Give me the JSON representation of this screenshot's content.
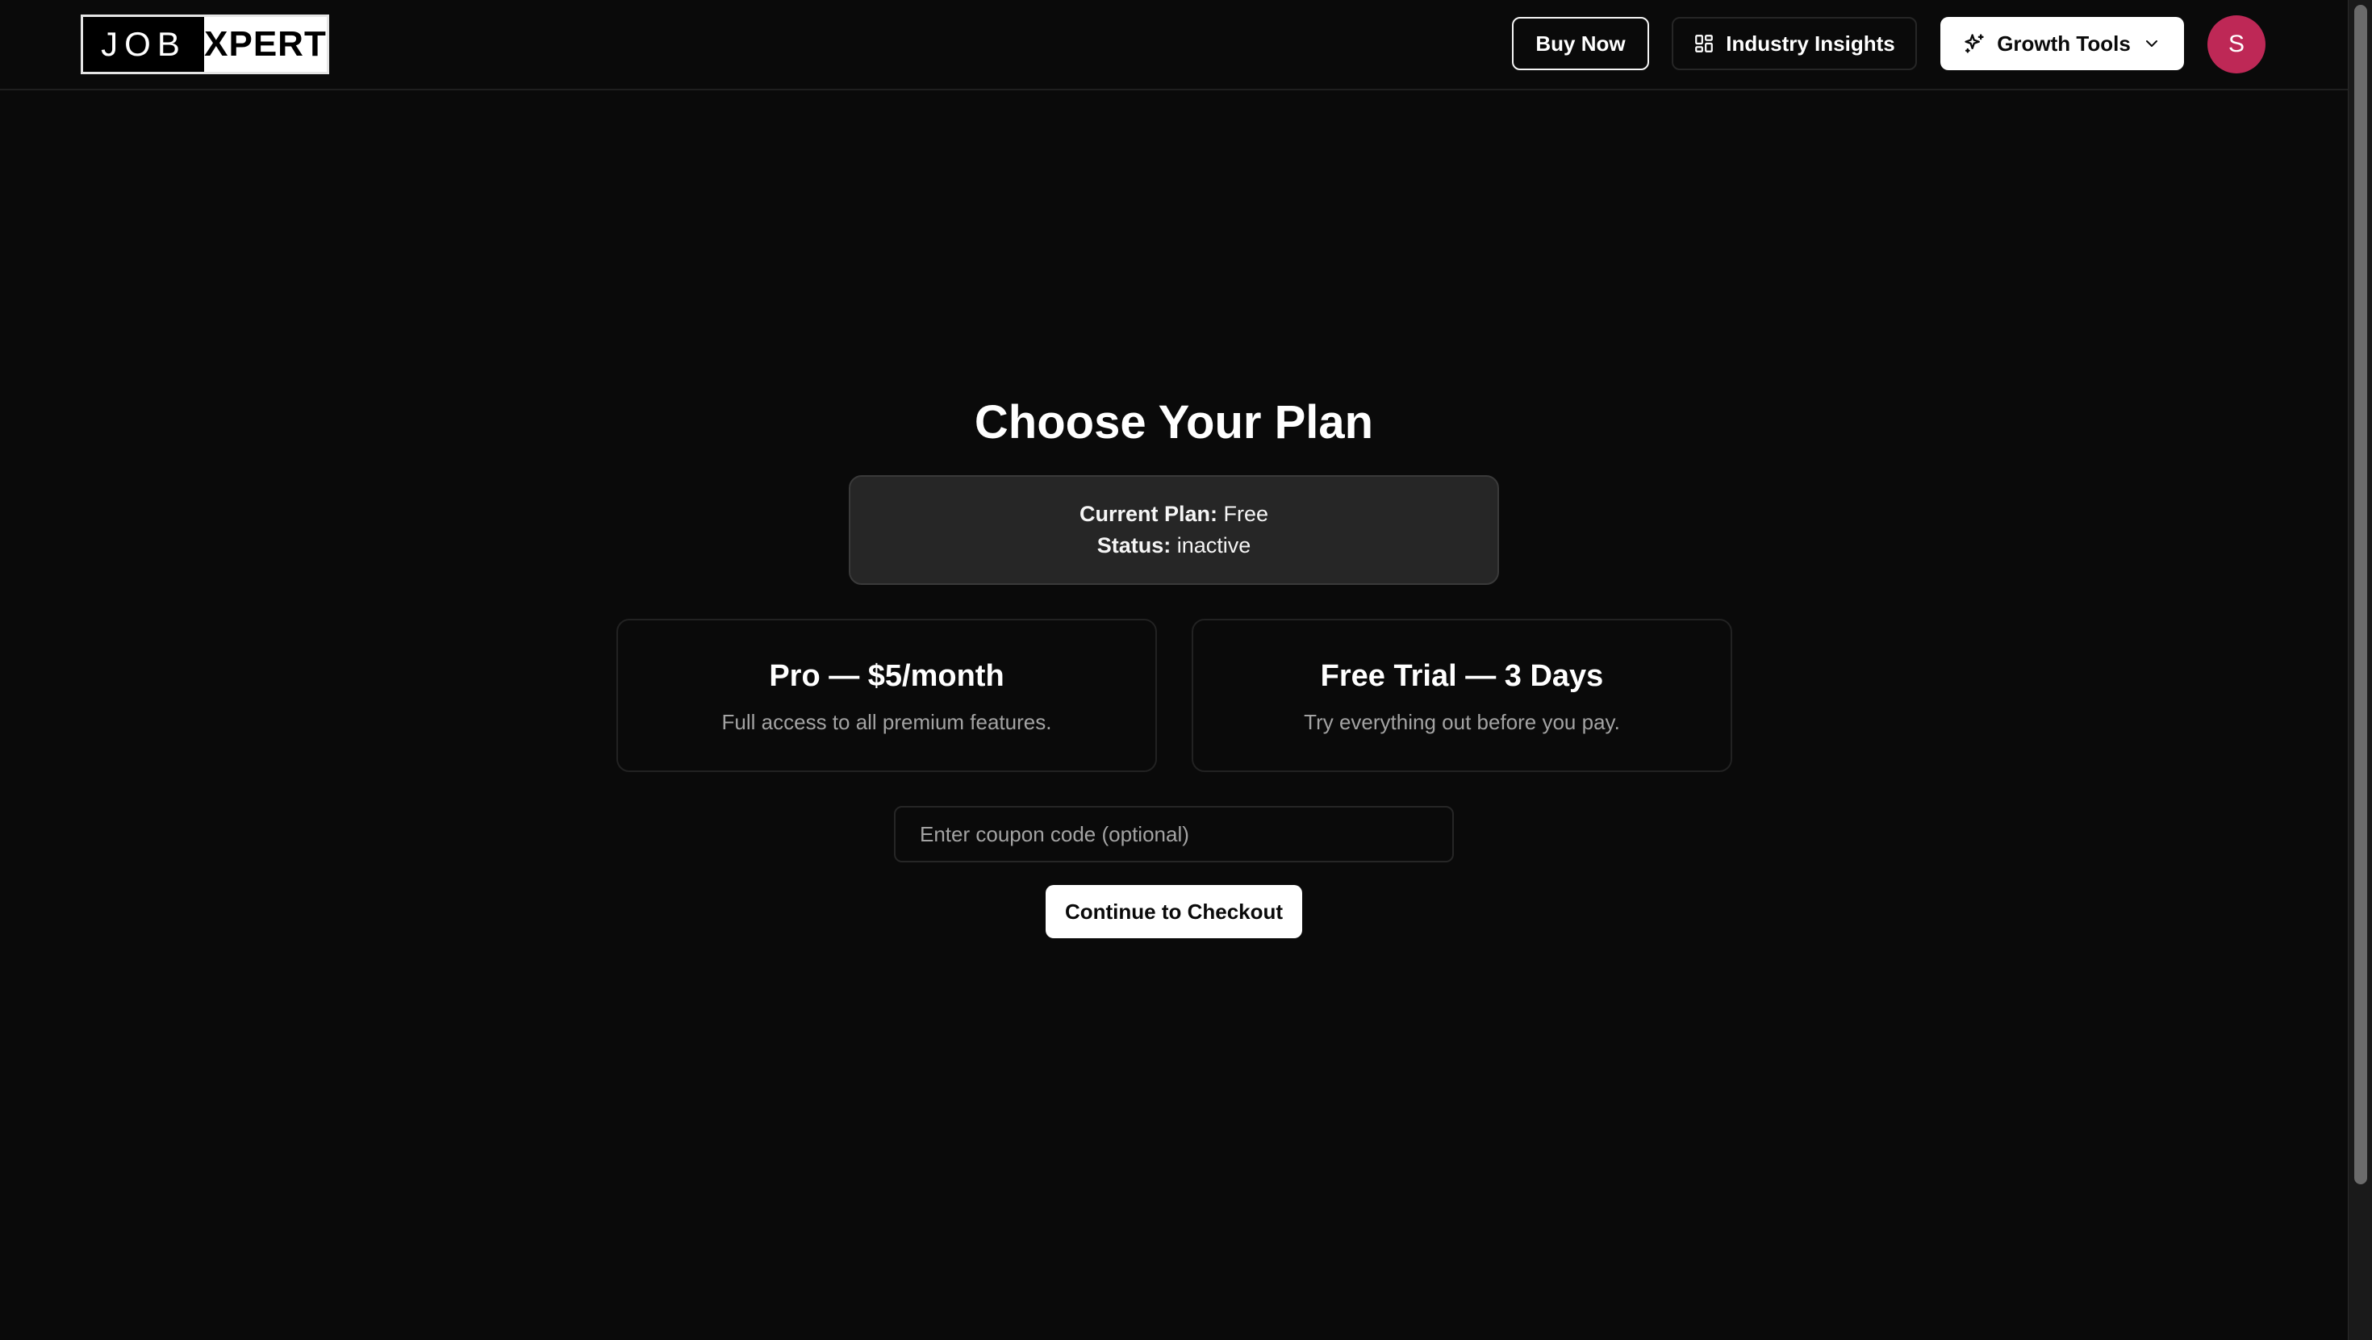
{
  "header": {
    "logo": {
      "left_text": "JOB",
      "right_text": "XPERT"
    },
    "buy_now_label": "Buy Now",
    "industry_insights_label": "Industry Insights",
    "growth_tools_label": "Growth Tools",
    "avatar_initial": "S"
  },
  "main": {
    "title": "Choose Your Plan",
    "status": {
      "current_plan_label": "Current Plan:",
      "current_plan_value": "Free",
      "status_label": "Status:",
      "status_value": "inactive"
    },
    "plans": [
      {
        "title": "Pro — $5/month",
        "description": "Full access to all premium features."
      },
      {
        "title": "Free Trial — 3 Days",
        "description": "Try everything out before you pay."
      }
    ],
    "coupon_placeholder": "Enter coupon code (optional)",
    "checkout_label": "Continue to Checkout"
  },
  "icons": {
    "insights": "dashboard-grid-icon",
    "growth": "sparkles-icon",
    "dropdown": "chevron-down-icon"
  },
  "colors": {
    "background": "#0a0a0a",
    "avatar": "#be2856",
    "primary_button": "#ffffff",
    "muted_text": "#a3a3a3"
  }
}
